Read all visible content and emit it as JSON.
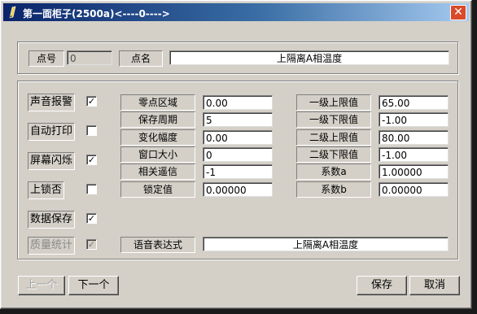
{
  "window": {
    "title": "第一面柜子(2500a)<----0---->",
    "close_glyph": "✕"
  },
  "top": {
    "point_no_label": "点号",
    "point_no_value": "0",
    "point_name_label": "点名",
    "point_name_value": "上隔离A相温度"
  },
  "checks": [
    {
      "label": "声音报警",
      "checked": true,
      "enabled": true
    },
    {
      "label": "自动打印",
      "checked": false,
      "enabled": true
    },
    {
      "label": "屏幕闪烁",
      "checked": true,
      "enabled": true
    },
    {
      "label": "上锁否",
      "checked": false,
      "enabled": true
    },
    {
      "label": "数据保存",
      "checked": true,
      "enabled": true
    },
    {
      "label": "质量统计",
      "checked": true,
      "enabled": false
    }
  ],
  "mid_fields": [
    {
      "label": "零点区域",
      "value": "0.00"
    },
    {
      "label": "保存周期",
      "value": "5"
    },
    {
      "label": "变化幅度",
      "value": "0.00"
    },
    {
      "label": "窗口大小",
      "value": "0"
    },
    {
      "label": "相关遥信",
      "value": "-1"
    },
    {
      "label": "锁定值",
      "value": "0.00000"
    }
  ],
  "right_fields": [
    {
      "label": "一级上限值",
      "value": "65.00"
    },
    {
      "label": "一级下限值",
      "value": "-1.00"
    },
    {
      "label": "二级上限值",
      "value": "80.00"
    },
    {
      "label": "二级下限值",
      "value": "-1.00"
    },
    {
      "label": "系数a",
      "value": "1.00000"
    },
    {
      "label": "系数b",
      "value": "0.00000"
    }
  ],
  "voice": {
    "label": "语音表达式",
    "value": "上隔离A相温度"
  },
  "buttons": {
    "prev": "上一个",
    "next": "下一个",
    "save": "保存",
    "cancel": "取消"
  },
  "colors": {
    "title_start": "#0a246a",
    "title_end": "#a6caf0",
    "close": "#d94a2a",
    "face": "#d4d0c8"
  }
}
